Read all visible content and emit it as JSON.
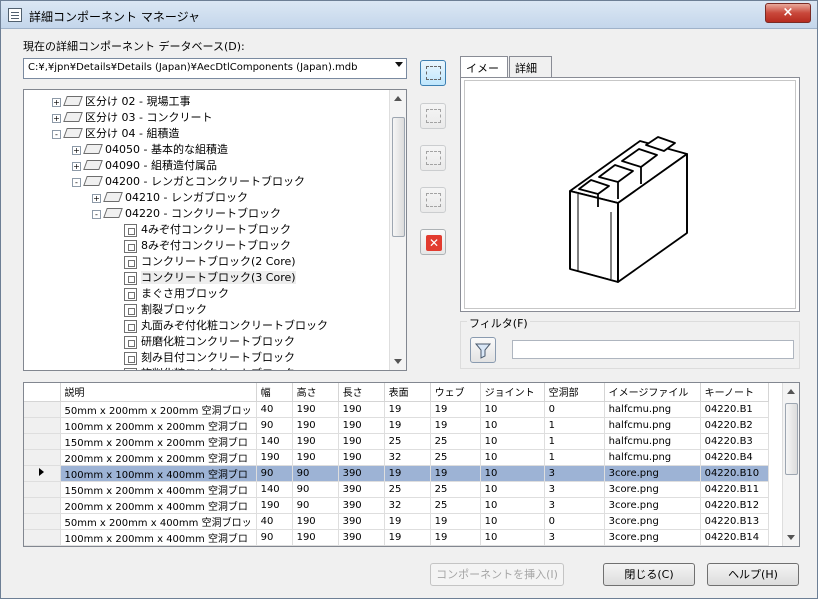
{
  "window": {
    "title": "詳細コンポーネント マネージャ",
    "close_icon": "×"
  },
  "database": {
    "label": "現在の詳細コンポーネント データベース(D):",
    "path": "C:¥,¥jpn¥Details¥Details (Japan)¥AecDtlComponents (Japan).mdb"
  },
  "tree": [
    {
      "label": "区分け 02 - 現場工事",
      "level": 1,
      "expander": "+",
      "icon": "folder"
    },
    {
      "label": "区分け 03 - コンクリート",
      "level": 1,
      "expander": "+",
      "icon": "folder"
    },
    {
      "label": "区分け 04 - 組積造",
      "level": 1,
      "expander": "-",
      "icon": "folder-open"
    },
    {
      "label": "04050 - 基本的な組積造",
      "level": 2,
      "expander": "+",
      "icon": "folder"
    },
    {
      "label": "04090 - 組積造付属品",
      "level": 2,
      "expander": "+",
      "icon": "folder"
    },
    {
      "label": "04200 - レンガとコンクリートブロック",
      "level": 2,
      "expander": "-",
      "icon": "folder-open"
    },
    {
      "label": "04210 - レンガブロック",
      "level": 3,
      "expander": "+",
      "icon": "folder"
    },
    {
      "label": "04220 - コンクリートブロック",
      "level": 3,
      "expander": "-",
      "icon": "folder-open"
    },
    {
      "label": "4みぞ付コンクリートブロック",
      "level": 4,
      "expander": "",
      "icon": "component"
    },
    {
      "label": "8みぞ付コンクリートブロック",
      "level": 4,
      "expander": "",
      "icon": "component"
    },
    {
      "label": "コンクリートブロック(2 Core)",
      "level": 4,
      "expander": "",
      "icon": "component"
    },
    {
      "label": "コンクリートブロック(3 Core)",
      "level": 4,
      "expander": "",
      "icon": "component",
      "selected": true
    },
    {
      "label": "まぐさ用ブロック",
      "level": 4,
      "expander": "",
      "icon": "component"
    },
    {
      "label": "割裂ブロック",
      "level": 4,
      "expander": "",
      "icon": "component"
    },
    {
      "label": "丸面みぞ付化粧コンクリートブロック",
      "level": 4,
      "expander": "",
      "icon": "component"
    },
    {
      "label": "研磨化粧コンクリートブロック",
      "level": 4,
      "expander": "",
      "icon": "component"
    },
    {
      "label": "刻み目付コンクリートブロック",
      "level": 4,
      "expander": "",
      "icon": "component"
    },
    {
      "label": "旋削化粧コンクリートブロック",
      "level": 4,
      "expander": "",
      "icon": "component"
    }
  ],
  "toolbar": {
    "icons": [
      "edit-database-icon",
      "open-folder-icon",
      "new-component-icon",
      "edit-component-icon",
      "delete-icon"
    ]
  },
  "preview": {
    "tabs": [
      "イメージ",
      "詳細"
    ],
    "active_tab": "イメージ"
  },
  "filter": {
    "label": "フィルタ(F)",
    "placeholder": ""
  },
  "grid": {
    "columns": [
      "説明",
      "幅",
      "高さ",
      "長さ",
      "表面",
      "ウェブ",
      "ジョイント",
      "空洞部",
      "イメージファイル",
      "キーノート"
    ],
    "rows": [
      [
        "50mm x 200mm x 200mm 空洞ブロッ",
        "40",
        "190",
        "190",
        "19",
        "19",
        "10",
        "0",
        "halfcmu.png",
        "04220.B1"
      ],
      [
        "100mm x 200mm x 200mm 空洞ブロ",
        "90",
        "190",
        "190",
        "19",
        "19",
        "10",
        "1",
        "halfcmu.png",
        "04220.B2"
      ],
      [
        "150mm x 200mm x 200mm 空洞ブロ",
        "140",
        "190",
        "190",
        "25",
        "25",
        "10",
        "1",
        "halfcmu.png",
        "04220.B3"
      ],
      [
        "200mm x 200mm x 200mm 空洞ブロ",
        "190",
        "190",
        "190",
        "32",
        "25",
        "10",
        "1",
        "halfcmu.png",
        "04220.B4"
      ],
      [
        "100mm x 100mm x 400mm 空洞ブロ",
        "90",
        "90",
        "390",
        "19",
        "19",
        "10",
        "3",
        "3core.png",
        "04220.B10"
      ],
      [
        "150mm x 200mm x 400mm 空洞ブロ",
        "140",
        "90",
        "390",
        "25",
        "25",
        "10",
        "3",
        "3core.png",
        "04220.B11"
      ],
      [
        "200mm x 200mm x 400mm 空洞ブロ",
        "190",
        "90",
        "390",
        "32",
        "25",
        "10",
        "3",
        "3core.png",
        "04220.B12"
      ],
      [
        "50mm x 200mm x 400mm 空洞ブロッ",
        "40",
        "190",
        "390",
        "19",
        "19",
        "10",
        "0",
        "3core.png",
        "04220.B13"
      ],
      [
        "100mm x 200mm x 400mm 空洞ブロ",
        "90",
        "190",
        "390",
        "19",
        "19",
        "10",
        "3",
        "3core.png",
        "04220.B14"
      ]
    ],
    "selected_row": 4
  },
  "buttons": {
    "insert": "コンポーネントを挿入(I)",
    "close": "閉じる(C)",
    "help": "ヘルプ(H)"
  }
}
